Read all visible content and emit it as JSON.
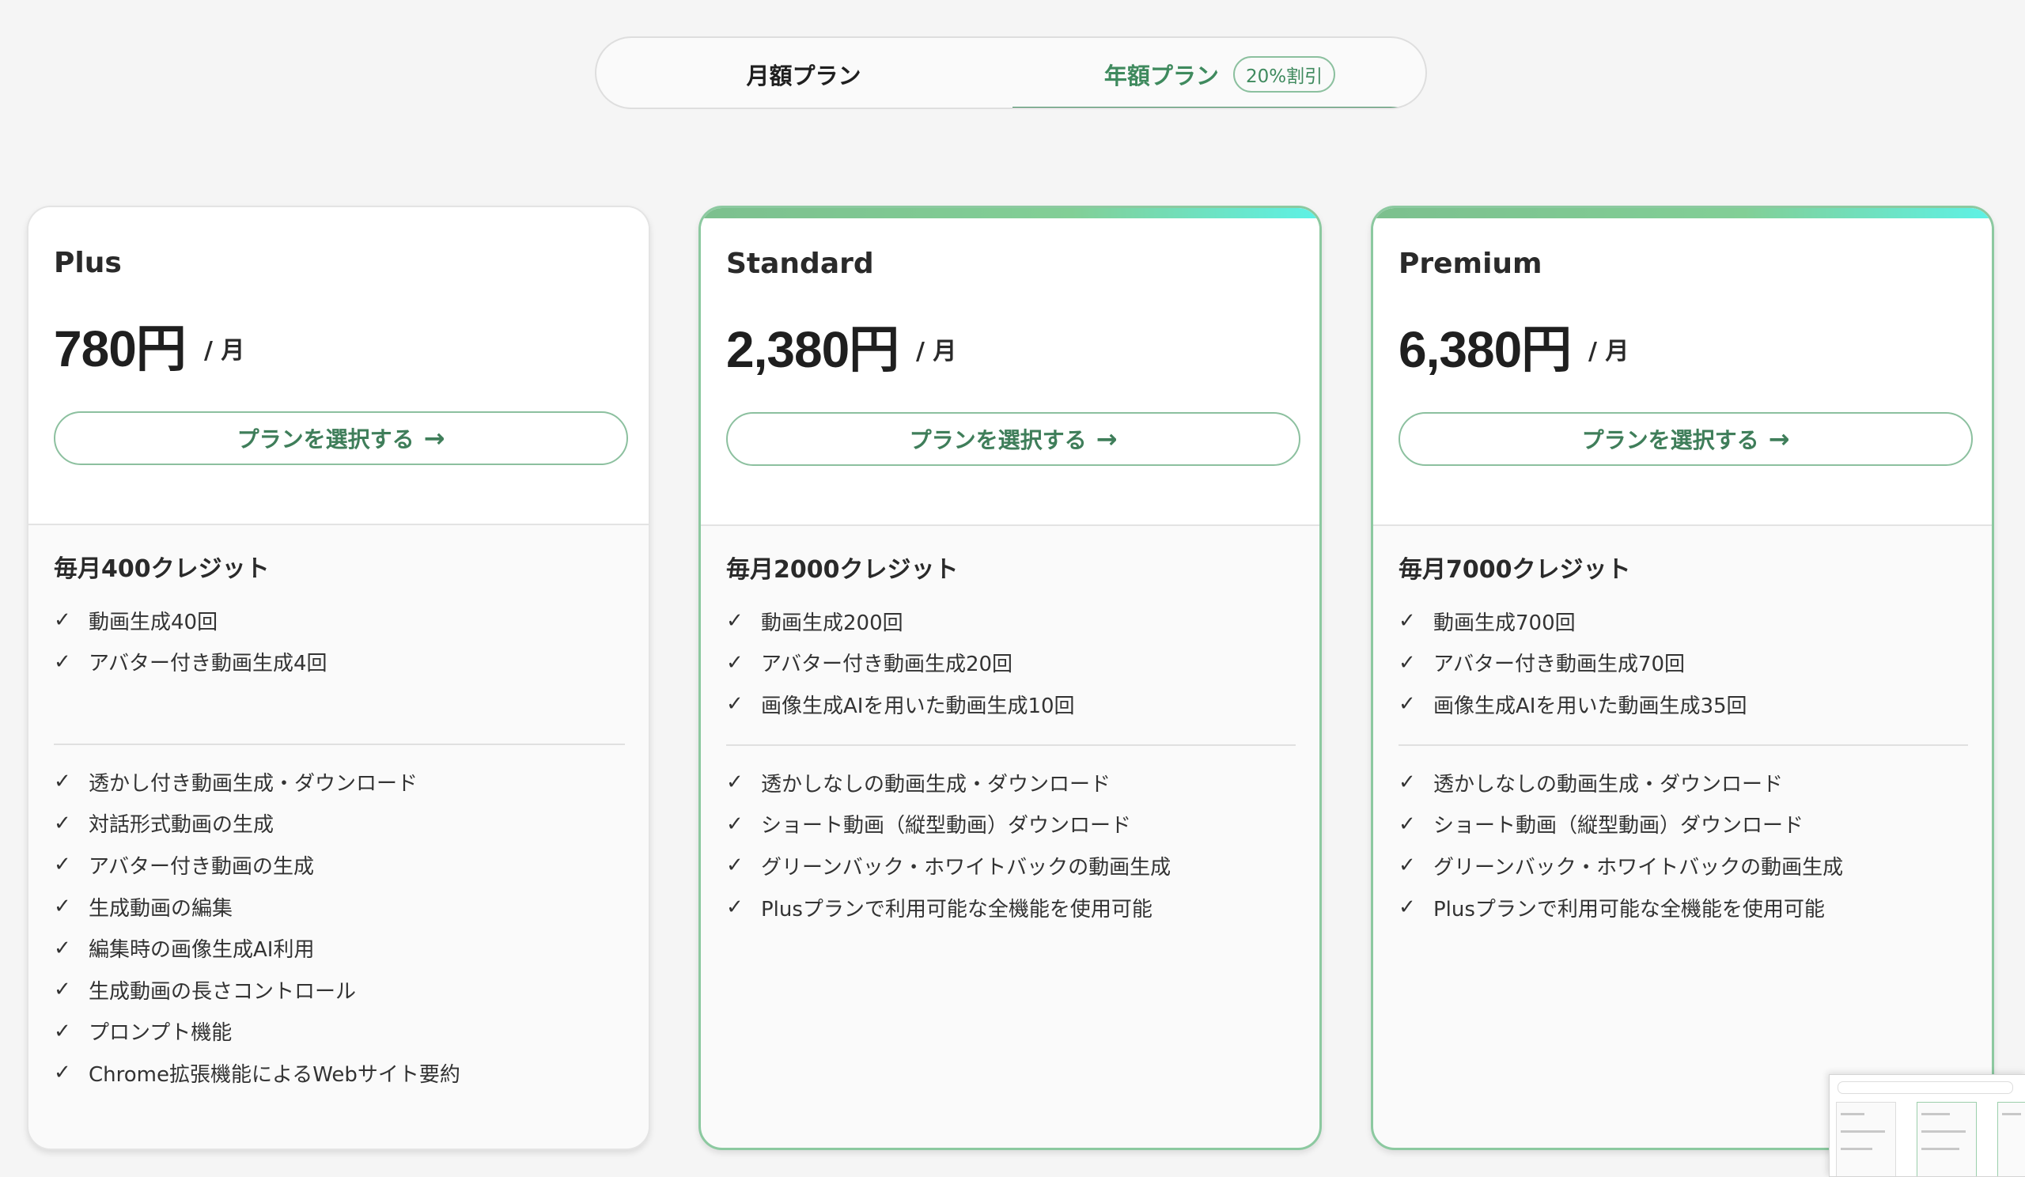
{
  "billing_toggle": {
    "monthly_label": "月額プラン",
    "annual_label": "年額プラン",
    "annual_badge": "20%割引",
    "active": "annual"
  },
  "accent_color": "#3f8a5e",
  "plans": [
    {
      "name": "Plus",
      "price": "780円",
      "per": "/ 月",
      "button_label": "プランを選択する",
      "credits": "毎月400クレジット",
      "quota_features": [
        "動画生成40回",
        "アバター付き動画生成4回"
      ],
      "features": [
        "透かし付き動画生成・ダウンロード",
        "対話形式動画の生成",
        "アバター付き動画の生成",
        "生成動画の編集",
        "編集時の画像生成AI利用",
        "生成動画の長さコントロール",
        "プロンプト機能",
        "Chrome拡張機能によるWebサイト要約"
      ]
    },
    {
      "name": "Standard",
      "price": "2,380円",
      "per": "/ 月",
      "button_label": "プランを選択する",
      "credits": "毎月2000クレジット",
      "quota_features": [
        "動画生成200回",
        "アバター付き動画生成20回",
        "画像生成AIを用いた動画生成10回"
      ],
      "features": [
        "透かしなしの動画生成・ダウンロード",
        "ショート動画（縦型動画）ダウンロード",
        "グリーンバック・ホワイトバックの動画生成",
        "Plusプランで利用可能な全機能を使用可能"
      ]
    },
    {
      "name": "Premium",
      "price": "6,380円",
      "per": "/ 月",
      "button_label": "プランを選択する",
      "credits": "毎月7000クレジット",
      "quota_features": [
        "動画生成700回",
        "アバター付き動画生成70回",
        "画像生成AIを用いた動画生成35回"
      ],
      "features": [
        "透かしなしの動画生成・ダウンロード",
        "ショート動画（縦型動画）ダウンロード",
        "グリーンバック・ホワイトバックの動画生成",
        "Plusプランで利用可能な全機能を使用可能"
      ]
    }
  ]
}
